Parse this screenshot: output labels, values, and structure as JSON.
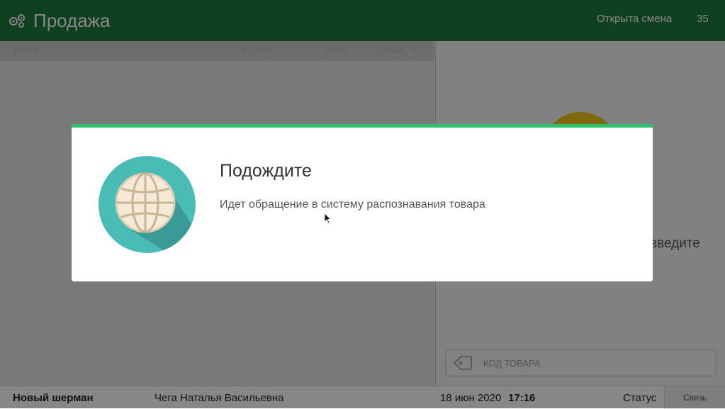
{
  "header": {
    "title": "Продажа",
    "shift_status": "Открыта смена",
    "shift_number": "35",
    "icon": "gears-icon",
    "background": "#1e7a3c"
  },
  "table": {
    "columns": [
      "ТОВАР",
      "КОЛ-ВО",
      "ЦЕНА",
      "СУММА - %"
    ]
  },
  "right_panel": {
    "hint_text": "введите",
    "code_input": {
      "placeholder": "КОД ТОВАРА",
      "icon": "tag-icon"
    }
  },
  "statusbar": {
    "store": "Новый шерман",
    "cashier": "Чега Наталья Васильевна",
    "date": "18 июн 2020",
    "time": "17:16",
    "status_label": "Статус",
    "connection_label": "Связь"
  },
  "dialog": {
    "title": "Подождите",
    "message": "Идет обращение в систему распознавания товара",
    "icon": "globe-icon",
    "accent": "#2bc16a"
  }
}
